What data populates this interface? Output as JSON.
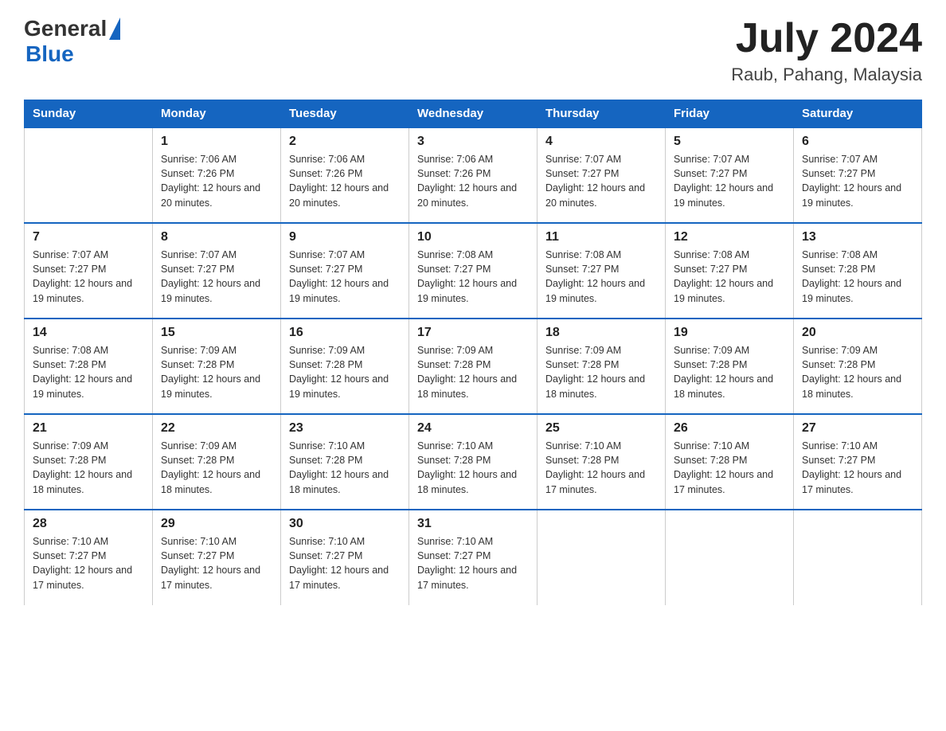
{
  "logo": {
    "text_general": "General",
    "text_blue": "Blue"
  },
  "title": "July 2024",
  "subtitle": "Raub, Pahang, Malaysia",
  "headers": [
    "Sunday",
    "Monday",
    "Tuesday",
    "Wednesday",
    "Thursday",
    "Friday",
    "Saturday"
  ],
  "weeks": [
    [
      {
        "day": "",
        "sunrise": "",
        "sunset": "",
        "daylight": ""
      },
      {
        "day": "1",
        "sunrise": "Sunrise: 7:06 AM",
        "sunset": "Sunset: 7:26 PM",
        "daylight": "Daylight: 12 hours and 20 minutes."
      },
      {
        "day": "2",
        "sunrise": "Sunrise: 7:06 AM",
        "sunset": "Sunset: 7:26 PM",
        "daylight": "Daylight: 12 hours and 20 minutes."
      },
      {
        "day": "3",
        "sunrise": "Sunrise: 7:06 AM",
        "sunset": "Sunset: 7:26 PM",
        "daylight": "Daylight: 12 hours and 20 minutes."
      },
      {
        "day": "4",
        "sunrise": "Sunrise: 7:07 AM",
        "sunset": "Sunset: 7:27 PM",
        "daylight": "Daylight: 12 hours and 20 minutes."
      },
      {
        "day": "5",
        "sunrise": "Sunrise: 7:07 AM",
        "sunset": "Sunset: 7:27 PM",
        "daylight": "Daylight: 12 hours and 19 minutes."
      },
      {
        "day": "6",
        "sunrise": "Sunrise: 7:07 AM",
        "sunset": "Sunset: 7:27 PM",
        "daylight": "Daylight: 12 hours and 19 minutes."
      }
    ],
    [
      {
        "day": "7",
        "sunrise": "Sunrise: 7:07 AM",
        "sunset": "Sunset: 7:27 PM",
        "daylight": "Daylight: 12 hours and 19 minutes."
      },
      {
        "day": "8",
        "sunrise": "Sunrise: 7:07 AM",
        "sunset": "Sunset: 7:27 PM",
        "daylight": "Daylight: 12 hours and 19 minutes."
      },
      {
        "day": "9",
        "sunrise": "Sunrise: 7:07 AM",
        "sunset": "Sunset: 7:27 PM",
        "daylight": "Daylight: 12 hours and 19 minutes."
      },
      {
        "day": "10",
        "sunrise": "Sunrise: 7:08 AM",
        "sunset": "Sunset: 7:27 PM",
        "daylight": "Daylight: 12 hours and 19 minutes."
      },
      {
        "day": "11",
        "sunrise": "Sunrise: 7:08 AM",
        "sunset": "Sunset: 7:27 PM",
        "daylight": "Daylight: 12 hours and 19 minutes."
      },
      {
        "day": "12",
        "sunrise": "Sunrise: 7:08 AM",
        "sunset": "Sunset: 7:27 PM",
        "daylight": "Daylight: 12 hours and 19 minutes."
      },
      {
        "day": "13",
        "sunrise": "Sunrise: 7:08 AM",
        "sunset": "Sunset: 7:28 PM",
        "daylight": "Daylight: 12 hours and 19 minutes."
      }
    ],
    [
      {
        "day": "14",
        "sunrise": "Sunrise: 7:08 AM",
        "sunset": "Sunset: 7:28 PM",
        "daylight": "Daylight: 12 hours and 19 minutes."
      },
      {
        "day": "15",
        "sunrise": "Sunrise: 7:09 AM",
        "sunset": "Sunset: 7:28 PM",
        "daylight": "Daylight: 12 hours and 19 minutes."
      },
      {
        "day": "16",
        "sunrise": "Sunrise: 7:09 AM",
        "sunset": "Sunset: 7:28 PM",
        "daylight": "Daylight: 12 hours and 19 minutes."
      },
      {
        "day": "17",
        "sunrise": "Sunrise: 7:09 AM",
        "sunset": "Sunset: 7:28 PM",
        "daylight": "Daylight: 12 hours and 18 minutes."
      },
      {
        "day": "18",
        "sunrise": "Sunrise: 7:09 AM",
        "sunset": "Sunset: 7:28 PM",
        "daylight": "Daylight: 12 hours and 18 minutes."
      },
      {
        "day": "19",
        "sunrise": "Sunrise: 7:09 AM",
        "sunset": "Sunset: 7:28 PM",
        "daylight": "Daylight: 12 hours and 18 minutes."
      },
      {
        "day": "20",
        "sunrise": "Sunrise: 7:09 AM",
        "sunset": "Sunset: 7:28 PM",
        "daylight": "Daylight: 12 hours and 18 minutes."
      }
    ],
    [
      {
        "day": "21",
        "sunrise": "Sunrise: 7:09 AM",
        "sunset": "Sunset: 7:28 PM",
        "daylight": "Daylight: 12 hours and 18 minutes."
      },
      {
        "day": "22",
        "sunrise": "Sunrise: 7:09 AM",
        "sunset": "Sunset: 7:28 PM",
        "daylight": "Daylight: 12 hours and 18 minutes."
      },
      {
        "day": "23",
        "sunrise": "Sunrise: 7:10 AM",
        "sunset": "Sunset: 7:28 PM",
        "daylight": "Daylight: 12 hours and 18 minutes."
      },
      {
        "day": "24",
        "sunrise": "Sunrise: 7:10 AM",
        "sunset": "Sunset: 7:28 PM",
        "daylight": "Daylight: 12 hours and 18 minutes."
      },
      {
        "day": "25",
        "sunrise": "Sunrise: 7:10 AM",
        "sunset": "Sunset: 7:28 PM",
        "daylight": "Daylight: 12 hours and 17 minutes."
      },
      {
        "day": "26",
        "sunrise": "Sunrise: 7:10 AM",
        "sunset": "Sunset: 7:28 PM",
        "daylight": "Daylight: 12 hours and 17 minutes."
      },
      {
        "day": "27",
        "sunrise": "Sunrise: 7:10 AM",
        "sunset": "Sunset: 7:27 PM",
        "daylight": "Daylight: 12 hours and 17 minutes."
      }
    ],
    [
      {
        "day": "28",
        "sunrise": "Sunrise: 7:10 AM",
        "sunset": "Sunset: 7:27 PM",
        "daylight": "Daylight: 12 hours and 17 minutes."
      },
      {
        "day": "29",
        "sunrise": "Sunrise: 7:10 AM",
        "sunset": "Sunset: 7:27 PM",
        "daylight": "Daylight: 12 hours and 17 minutes."
      },
      {
        "day": "30",
        "sunrise": "Sunrise: 7:10 AM",
        "sunset": "Sunset: 7:27 PM",
        "daylight": "Daylight: 12 hours and 17 minutes."
      },
      {
        "day": "31",
        "sunrise": "Sunrise: 7:10 AM",
        "sunset": "Sunset: 7:27 PM",
        "daylight": "Daylight: 12 hours and 17 minutes."
      },
      {
        "day": "",
        "sunrise": "",
        "sunset": "",
        "daylight": ""
      },
      {
        "day": "",
        "sunrise": "",
        "sunset": "",
        "daylight": ""
      },
      {
        "day": "",
        "sunrise": "",
        "sunset": "",
        "daylight": ""
      }
    ]
  ]
}
